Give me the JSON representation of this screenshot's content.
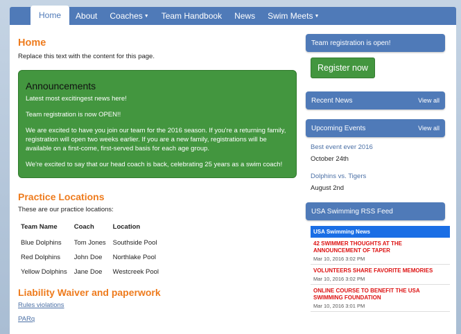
{
  "nav": {
    "items": [
      {
        "label": "Home",
        "active": true,
        "caret": false
      },
      {
        "label": "About",
        "active": false,
        "caret": false
      },
      {
        "label": "Coaches",
        "active": false,
        "caret": true
      },
      {
        "label": "Team Handbook",
        "active": false,
        "caret": false
      },
      {
        "label": "News",
        "active": false,
        "caret": false
      },
      {
        "label": "Swim Meets",
        "active": false,
        "caret": true
      }
    ]
  },
  "main": {
    "title": "Home",
    "lead": "Replace this text with the content for this page.",
    "announcements": {
      "heading": "Announcements",
      "paragraphs": [
        "Latest most excitingest news here!",
        "Team registration is now OPEN!!",
        "We are excited to have you join our team for the 2016 season.  If you're a returning family, registration will open two weeks earlier.  If you are a new family, registrations will be available on a first-come, first-served basis for each age group.",
        "We're excited to say that our head coach is back, celebrating 25 years as a swim coach!"
      ]
    },
    "practice": {
      "heading": "Practice Locations",
      "intro": "These are our practice locations:",
      "columns": [
        "Team Name",
        "Coach",
        "Location"
      ],
      "rows": [
        [
          "Blue Dolphins",
          "Tom Jones",
          "Southside Pool"
        ],
        [
          "Red Dolphins",
          "John Doe",
          "Northlake Pool"
        ],
        [
          "Yellow Dolphins",
          "Jane Doe",
          "Westcreek Pool"
        ]
      ]
    },
    "waiver": {
      "heading": "Liability Waiver and paperwork",
      "links": [
        "Rules violations",
        "PARq"
      ]
    }
  },
  "sidebar": {
    "registration": {
      "heading": "Team registration is open!",
      "button": "Register now"
    },
    "recent_news": {
      "heading": "Recent News",
      "view_all": "View all"
    },
    "upcoming": {
      "heading": "Upcoming Events",
      "view_all": "View all",
      "events": [
        {
          "title": "Best event ever 2016",
          "date": "October 24th"
        },
        {
          "title": "Dolphins vs. Tigers",
          "date": "August 2nd"
        }
      ]
    },
    "rss": {
      "heading": "USA Swimming RSS Feed",
      "feed_title": "USA Swimming News",
      "items": [
        {
          "title": "42 SWIMMER THOUGHTS AT THE ANNOUNCEMENT OF TAPER",
          "date": "Mar 10, 2016 3:02 PM"
        },
        {
          "title": "VOLUNTEERS SHARE FAVORITE MEMORIES",
          "date": "Mar 10, 2016 3:02 PM"
        },
        {
          "title": "ONLINE COURSE TO BENEFIT THE USA SWIMMING FOUNDATION",
          "date": "Mar 10, 2016 3:01 PM"
        }
      ]
    }
  },
  "colors": {
    "nav": "#4f7ab8",
    "accent_orange": "#ee7b1d",
    "green": "#43963f",
    "link": "#4a6fa5",
    "rss_red": "#dd1111"
  }
}
